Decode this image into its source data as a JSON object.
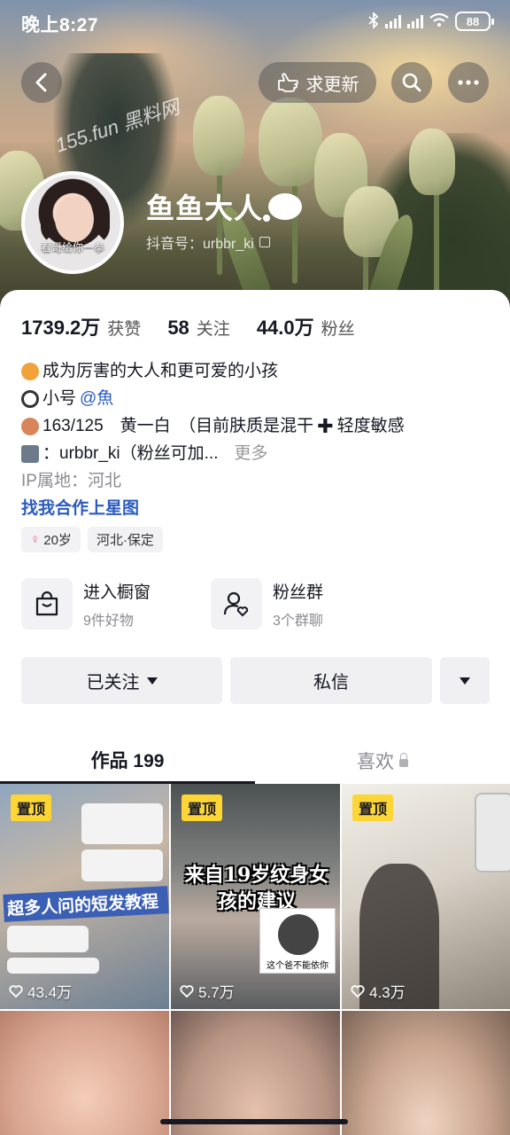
{
  "status_bar": {
    "time": "晚上8:27",
    "battery": "88"
  },
  "header": {
    "update_label": "求更新",
    "watermark": "155.fun 黑料网"
  },
  "profile": {
    "avatar_caption": "看哥给你一拳",
    "nickname": "鱼鱼大人",
    "handle": "抖音号：urbbr_ki"
  },
  "stats": [
    {
      "num": "1739.2万",
      "label": "获赞"
    },
    {
      "num": "58",
      "label": "关注"
    },
    {
      "num": "44.0万",
      "label": "粉丝"
    }
  ],
  "bio": {
    "line1": "成为厉害的大人和更可爱的小孩",
    "line2_prefix": "小号",
    "line2_link": "@魚",
    "line3": "163/125　黄一白　（目前肤质是混干",
    "line3_suffix": "轻度敏感",
    "line4": "：urbbr_ki（粉丝可加...",
    "more": "更多",
    "ip": "IP属地：河北",
    "star_link": "找我合作上星图"
  },
  "tags": {
    "age": "20岁",
    "location": "河北·保定"
  },
  "features": {
    "shop_title": "进入橱窗",
    "shop_sub": "9件好物",
    "group_title": "粉丝群",
    "group_sub": "3个群聊"
  },
  "actions": {
    "follow": "已关注",
    "message": "私信"
  },
  "tabs": {
    "works": "作品 199",
    "likes": "喜欢"
  },
  "videos": [
    {
      "pinned": "置顶",
      "likes": "43.4万",
      "overlay": "超多人问的短发教程"
    },
    {
      "pinned": "置顶",
      "likes": "5.7万",
      "overlay": "来自19岁纹身女孩的建议",
      "meme_caption": "这个爸不能依你"
    },
    {
      "pinned": "置顶",
      "likes": "4.3万"
    },
    {},
    {},
    {}
  ],
  "colors": {
    "pin_bg": "#fdd535",
    "link": "#2b5bbf",
    "card_bg": "#ffffff"
  }
}
